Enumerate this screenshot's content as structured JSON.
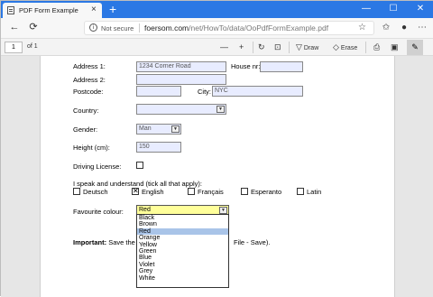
{
  "browser": {
    "tab_title": "PDF Form Example",
    "tab_close": "×",
    "new_tab": "+",
    "window_controls": [
      "—",
      "☐",
      "✕"
    ],
    "nav": {
      "back": "←",
      "refresh": "⟳"
    },
    "url": {
      "security_label": "Not secure",
      "host": "foersom.com",
      "path": "/net/HowTo/data/OoPdfFormExample.pdf"
    }
  },
  "pdf_toolbar": {
    "page_number": "1",
    "page_total": "of 1",
    "draw_label": "Draw",
    "erase_label": "Erase"
  },
  "form": {
    "address1_label": "Address 1:",
    "address1_value": "1234 Corner Road",
    "house_nr_label": "House nr:",
    "address2_label": "Address 2:",
    "postcode_label": "Postcode:",
    "city_label": "City:",
    "city_value": "NYC",
    "country_label": "Country:",
    "gender_label": "Gender:",
    "gender_value": "Man",
    "height_label": "Height (cm):",
    "height_value": "150",
    "driving_label": "Driving License:",
    "languages_label": "I speak and understand (tick all that apply):",
    "languages": [
      {
        "label": "Deutsch",
        "checked": false
      },
      {
        "label": "English",
        "checked": true
      },
      {
        "label": "Français",
        "checked": false
      },
      {
        "label": "Esperanto",
        "checked": false
      },
      {
        "label": "Latin",
        "checked": false
      }
    ],
    "colour_label": "Favourite colour:",
    "colour_value": "Red",
    "colour_options": [
      "Black",
      "Brown",
      "Red",
      "Orange",
      "Yellow",
      "Green",
      "Blue",
      "Violet",
      "Grey",
      "White"
    ],
    "colour_selected": "Red",
    "important_bold": "Important:",
    "important_text_left": "Save the",
    "important_text_right": "File - Save)."
  }
}
